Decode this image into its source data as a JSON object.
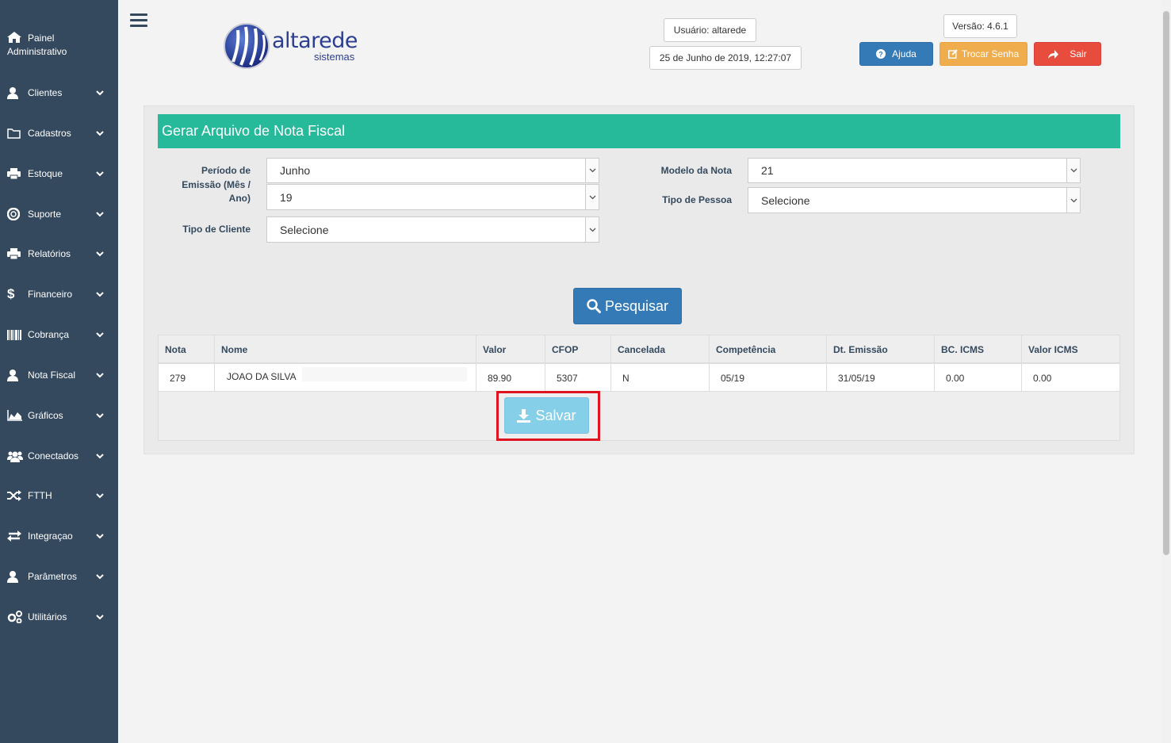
{
  "sidebar": {
    "painel": [
      "Painel",
      "Administrativo"
    ],
    "items": [
      {
        "label": "Clientes",
        "icon": "user-icon"
      },
      {
        "label": "Cadastros",
        "icon": "folder-icon"
      },
      {
        "label": "Estoque",
        "icon": "print-icon"
      },
      {
        "label": "Suporte",
        "icon": "lifebuoy-icon"
      },
      {
        "label": "Relatórios",
        "icon": "print-icon"
      },
      {
        "label": "Financeiro",
        "icon": "dollar-icon"
      },
      {
        "label": "Cobrança",
        "icon": "barcode-icon"
      },
      {
        "label": "Nota Fiscal",
        "icon": "user-icon"
      },
      {
        "label": "Gráficos",
        "icon": "area-chart-icon"
      },
      {
        "label": "Conectados",
        "icon": "users-icon"
      },
      {
        "label": "FTTH",
        "icon": "shuffle-icon"
      },
      {
        "label": "Integraçao",
        "icon": "exchange-icon"
      },
      {
        "label": "Parâmetros",
        "icon": "user-icon"
      },
      {
        "label": "Utilitários",
        "icon": "cogs-icon"
      }
    ]
  },
  "header": {
    "logo_word": "altarede",
    "logo_sub": "sistemas",
    "user": "Usuário: altarede",
    "datetime": "25 de Junho de 2019, 12:27:07",
    "version": "Versão: 4.6.1",
    "help_label": "Ajuda",
    "change_password_label": "Trocar Senha",
    "logout_label": "Sair"
  },
  "form": {
    "title": "Gerar Arquivo de Nota Fiscal",
    "period_label": [
      "Período de",
      "Emissão (Mês /",
      "Ano)"
    ],
    "month_value": "Junho",
    "year_value": "19",
    "client_type_label": "Tipo de Cliente",
    "client_type_value": "Selecione",
    "model_label": "Modelo da Nota",
    "model_value": "21",
    "person_type_label": "Tipo de Pessoa",
    "person_type_value": "Selecione",
    "search_label": "Pesquisar",
    "save_label": "Salvar"
  },
  "table": {
    "headers": [
      "Nota",
      "Nome",
      "Valor",
      "CFOP",
      "Cancelada",
      "Competência",
      "Dt. Emissão",
      "BC. ICMS",
      "Valor ICMS"
    ],
    "rows": [
      [
        "279",
        "JOAO DA SILVA",
        "89.90",
        "5307",
        "N",
        "05/19",
        "31/05/19",
        "0.00",
        "0.00"
      ]
    ]
  },
  "colors": {
    "sidebar": "#34495e",
    "title_bar": "#26b99a",
    "primary": "#337ab7",
    "warning": "#f0ad4e",
    "danger": "#e74c3c",
    "info_light": "#86cfe9",
    "highlight": "#e0141e"
  }
}
